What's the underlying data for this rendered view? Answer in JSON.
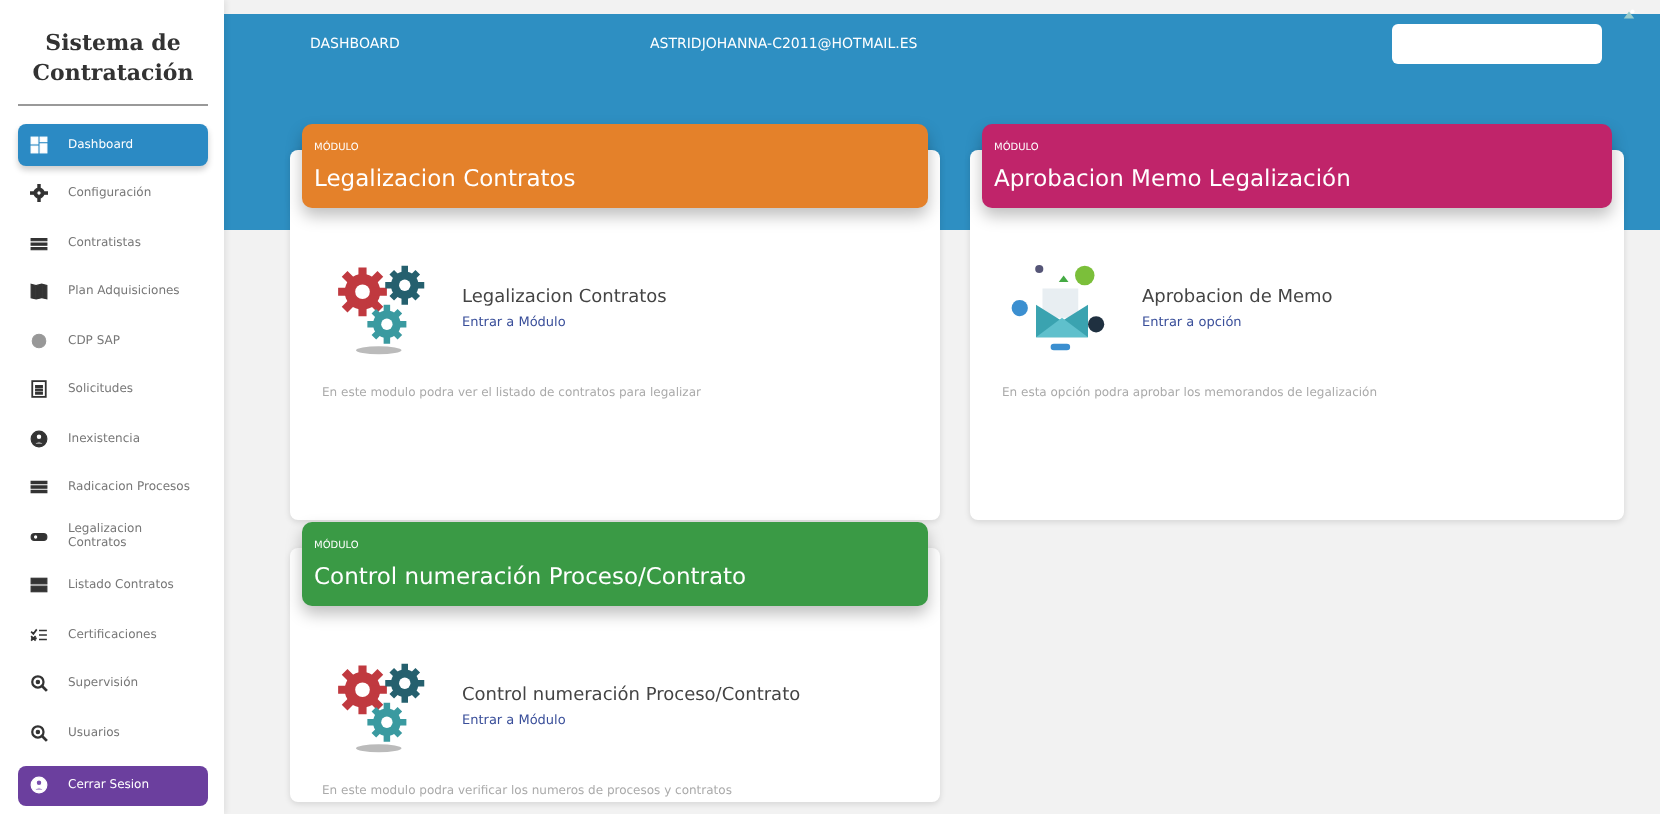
{
  "sidebar": {
    "title": "Sistema de Contratación",
    "items": [
      {
        "label": "Dashboard",
        "kind": "nav",
        "selected": true
      },
      {
        "label": "Configuración",
        "kind": "nav",
        "selected": false
      },
      {
        "label": "Contratistas",
        "kind": "nav",
        "selected": false
      },
      {
        "label": "Plan Adquisiciones",
        "kind": "nav",
        "selected": false
      },
      {
        "label": "CDP SAP",
        "kind": "nav",
        "selected": false
      },
      {
        "label": "Solicitudes",
        "kind": "nav",
        "selected": false
      },
      {
        "label": "Inexistencia",
        "kind": "nav",
        "selected": false
      },
      {
        "label": "Radicacion Procesos",
        "kind": "nav",
        "selected": false
      },
      {
        "label": "Legalizacion Contratos",
        "kind": "nav",
        "selected": false
      },
      {
        "label": "Listado Contratos",
        "kind": "nav",
        "selected": false
      },
      {
        "label": "Certificaciones",
        "kind": "nav",
        "selected": false
      },
      {
        "label": "Supervisión",
        "kind": "nav",
        "selected": false
      },
      {
        "label": "Usuarios",
        "kind": "nav",
        "selected": false
      },
      {
        "label": "Cerrar Sesion",
        "kind": "logout",
        "selected": false
      }
    ]
  },
  "header": {
    "title": "DASHBOARD",
    "user": "ASTRIDJOHANNA-C2011@HOTMAIL.ES"
  },
  "cards": [
    {
      "kicker": "MÓDULO",
      "title": "Legalizacion Contratos",
      "color": "#e4812a",
      "kind": "gears",
      "name": "Legalizacion Contratos",
      "link": "Entrar a Módulo",
      "description": "En este modulo podra ver el listado de contratos para legalizar"
    },
    {
      "kicker": "MÓDULO",
      "title": "Aprobacion Memo Legalización",
      "color": "#c0246a",
      "kind": "memo",
      "name": "Aprobacion de Memo",
      "link": "Entrar a opción",
      "description": "En esta opción podra aprobar los memorandos de legalización"
    },
    {
      "kicker": "MÓDULO",
      "title": "Control numeración Proceso/Contrato",
      "color": "#3a9a45",
      "kind": "gears",
      "name": "Control numeración Proceso/Contrato",
      "link": "Entrar a Módulo",
      "description": "En este modulo podra verificar los numeros de procesos y contratos"
    }
  ]
}
